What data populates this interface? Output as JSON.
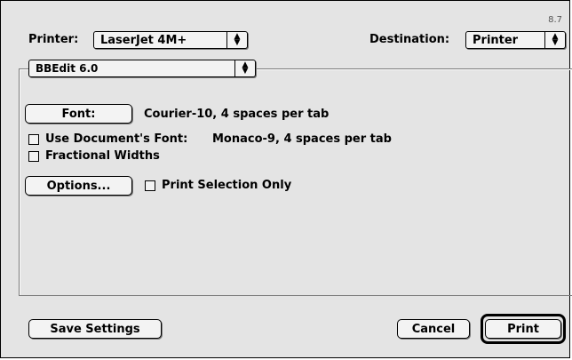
{
  "version_label": "8.7",
  "printer": {
    "label": "Printer:",
    "selected": "LaserJet 4M+"
  },
  "destination": {
    "label": "Destination:",
    "selected": "Printer"
  },
  "app_section": {
    "selected": "BBEdit 6.0"
  },
  "font": {
    "button_label": "Font:",
    "value": "Courier-10, 4 spaces per tab"
  },
  "use_document_font": {
    "label": "Use Document's Font:",
    "value": "Monaco-9, 4 spaces per tab",
    "checked": false
  },
  "fractional_widths": {
    "label": "Fractional Widths",
    "checked": false
  },
  "options_button": {
    "label": "Options..."
  },
  "print_selection_only": {
    "label": "Print Selection Only",
    "checked": false
  },
  "footer": {
    "save_label": "Save Settings",
    "cancel_label": "Cancel",
    "print_label": "Print"
  },
  "icons": {
    "popup_arrows": "up-down-arrows-icon",
    "checkbox": "checkbox-icon"
  }
}
